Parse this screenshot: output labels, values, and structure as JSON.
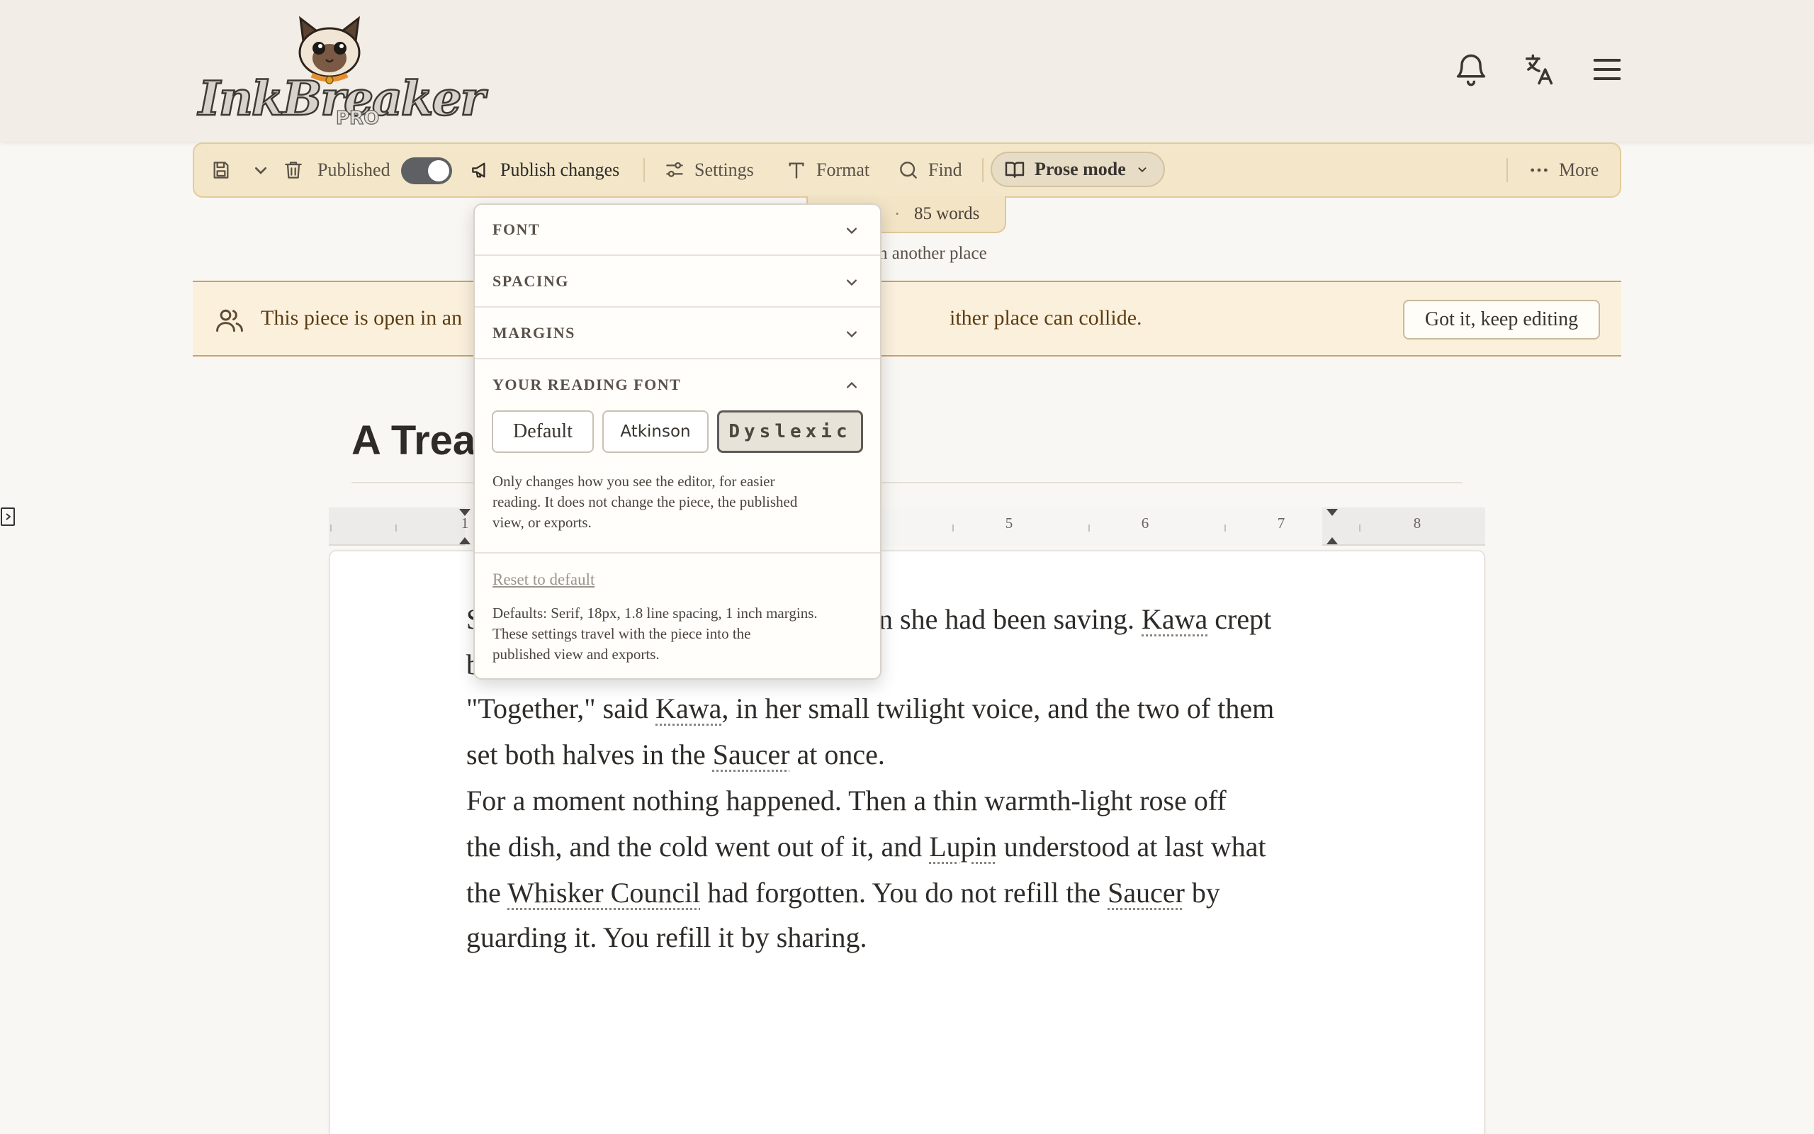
{
  "header": {
    "logo_text": "InkBreaker",
    "logo_badge": "PRO",
    "icons": [
      "bell-icon",
      "translate-icon",
      "hamburger-menu-icon"
    ]
  },
  "toolbar": {
    "published_label": "Published",
    "published_on": true,
    "publish_changes_label": "Publish changes",
    "settings_label": "Settings",
    "format_label": "Format",
    "find_label": "Find",
    "prose_mode_label": "Prose mode",
    "more_label": "More"
  },
  "status": {
    "word_count": "85 words",
    "separator": "·",
    "notice_fragment": "n another place"
  },
  "banner": {
    "text_start": "This piece is open in an",
    "text_end": "ither place can collide.",
    "button_label": "Got it, keep editing"
  },
  "document": {
    "title_visible": "A Trea",
    "ruler_numbers": [
      "1",
      "5",
      "6",
      "7",
      "8"
    ],
    "paragraphs": [
      {
        "line1": [
          "S",
          "n she had been saving. ",
          {
            "name": "Kawa"
          },
          " crept"
        ],
        "line2": [
          "b",
          "."
        ]
      },
      {
        "lines": [
          [
            "\"Together,\" said ",
            {
              "name": "Kawa"
            },
            ", in her small twilight voice, and the two of them"
          ],
          [
            "set both halves in the ",
            {
              "name": "Saucer"
            },
            " at once."
          ]
        ]
      },
      {
        "lines": [
          [
            "For a moment nothing happened. Then a thin warmth-light rose off"
          ],
          [
            "the dish, and the cold went out of it, and ",
            {
              "name": "Lupin"
            },
            " understood at last what"
          ],
          [
            "the ",
            {
              "name": "Whisker Council"
            },
            " had forgotten. You do not refill the ",
            {
              "name": "Saucer"
            },
            " by"
          ],
          [
            "guarding it. You refill it by sharing."
          ]
        ]
      }
    ]
  },
  "format_panel": {
    "sections": [
      {
        "label": "FONT",
        "expanded": false
      },
      {
        "label": "SPACING",
        "expanded": false
      },
      {
        "label": "MARGINS",
        "expanded": false
      },
      {
        "label": "YOUR READING FONT",
        "expanded": true
      }
    ],
    "font_options": [
      {
        "label": "Default",
        "selected": false
      },
      {
        "label": "Atkinson",
        "selected": false
      },
      {
        "label": "Dyslexic",
        "selected": true
      }
    ],
    "note_lines": [
      "Only changes how you see the editor, for easier",
      "reading. It does not change the piece, the published",
      "view, or exports."
    ],
    "reset_label": "Reset to default",
    "defaults_lines": [
      "Defaults: Serif, 18px, 1.8 line spacing, 1 inch margins.",
      "These settings travel with the piece into the",
      "published view and exports."
    ]
  },
  "colors": {
    "toolbar_bg": "#f3e6c9",
    "banner_bg": "#fbf0dc",
    "banner_border": "#caa066",
    "toggle_track": "#5e6064",
    "selected_chip": "#e8e3d9"
  }
}
